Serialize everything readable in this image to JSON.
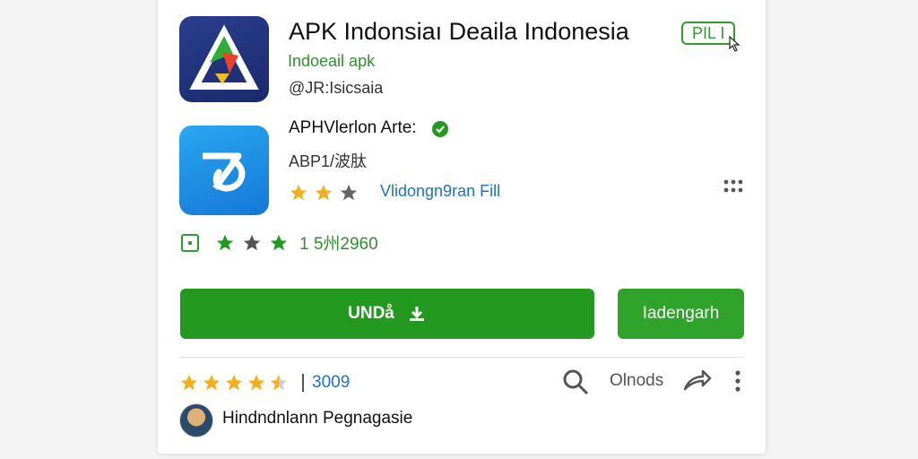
{
  "app": {
    "title": "APK Indonsiaı Deaila Indonesia",
    "badge": "PIL I",
    "subtitle_green": "Indoeail apk",
    "subtitle_gray": "@JR:Isicsaia"
  },
  "developer": {
    "name": "APHVlerlon Arte:",
    "sub": "ABP1/波肽",
    "link": "Vlidongn9ran Fill",
    "stars": [
      "filled",
      "filled",
      "empty"
    ]
  },
  "stats": {
    "count": "1 5州2960",
    "stars": [
      "filled",
      "filled",
      "filled"
    ]
  },
  "buttons": {
    "install_label": "UNDå",
    "open_label": "Iadengarh"
  },
  "rating": {
    "count": "3009",
    "stars": [
      1,
      1,
      1,
      1,
      0.5
    ]
  },
  "actions": {
    "label": "Olnods"
  },
  "author": {
    "name": "Hindndnlann Pegnagasie"
  },
  "colors": {
    "primary_green": "#23991f",
    "star_gold": "#f2b01e",
    "link_blue": "#1d6fd6"
  },
  "icons": [
    "app-logo-triangle",
    "app-logo-swirl",
    "verified-check",
    "star",
    "download",
    "search",
    "share",
    "more-vert",
    "grid-more"
  ]
}
